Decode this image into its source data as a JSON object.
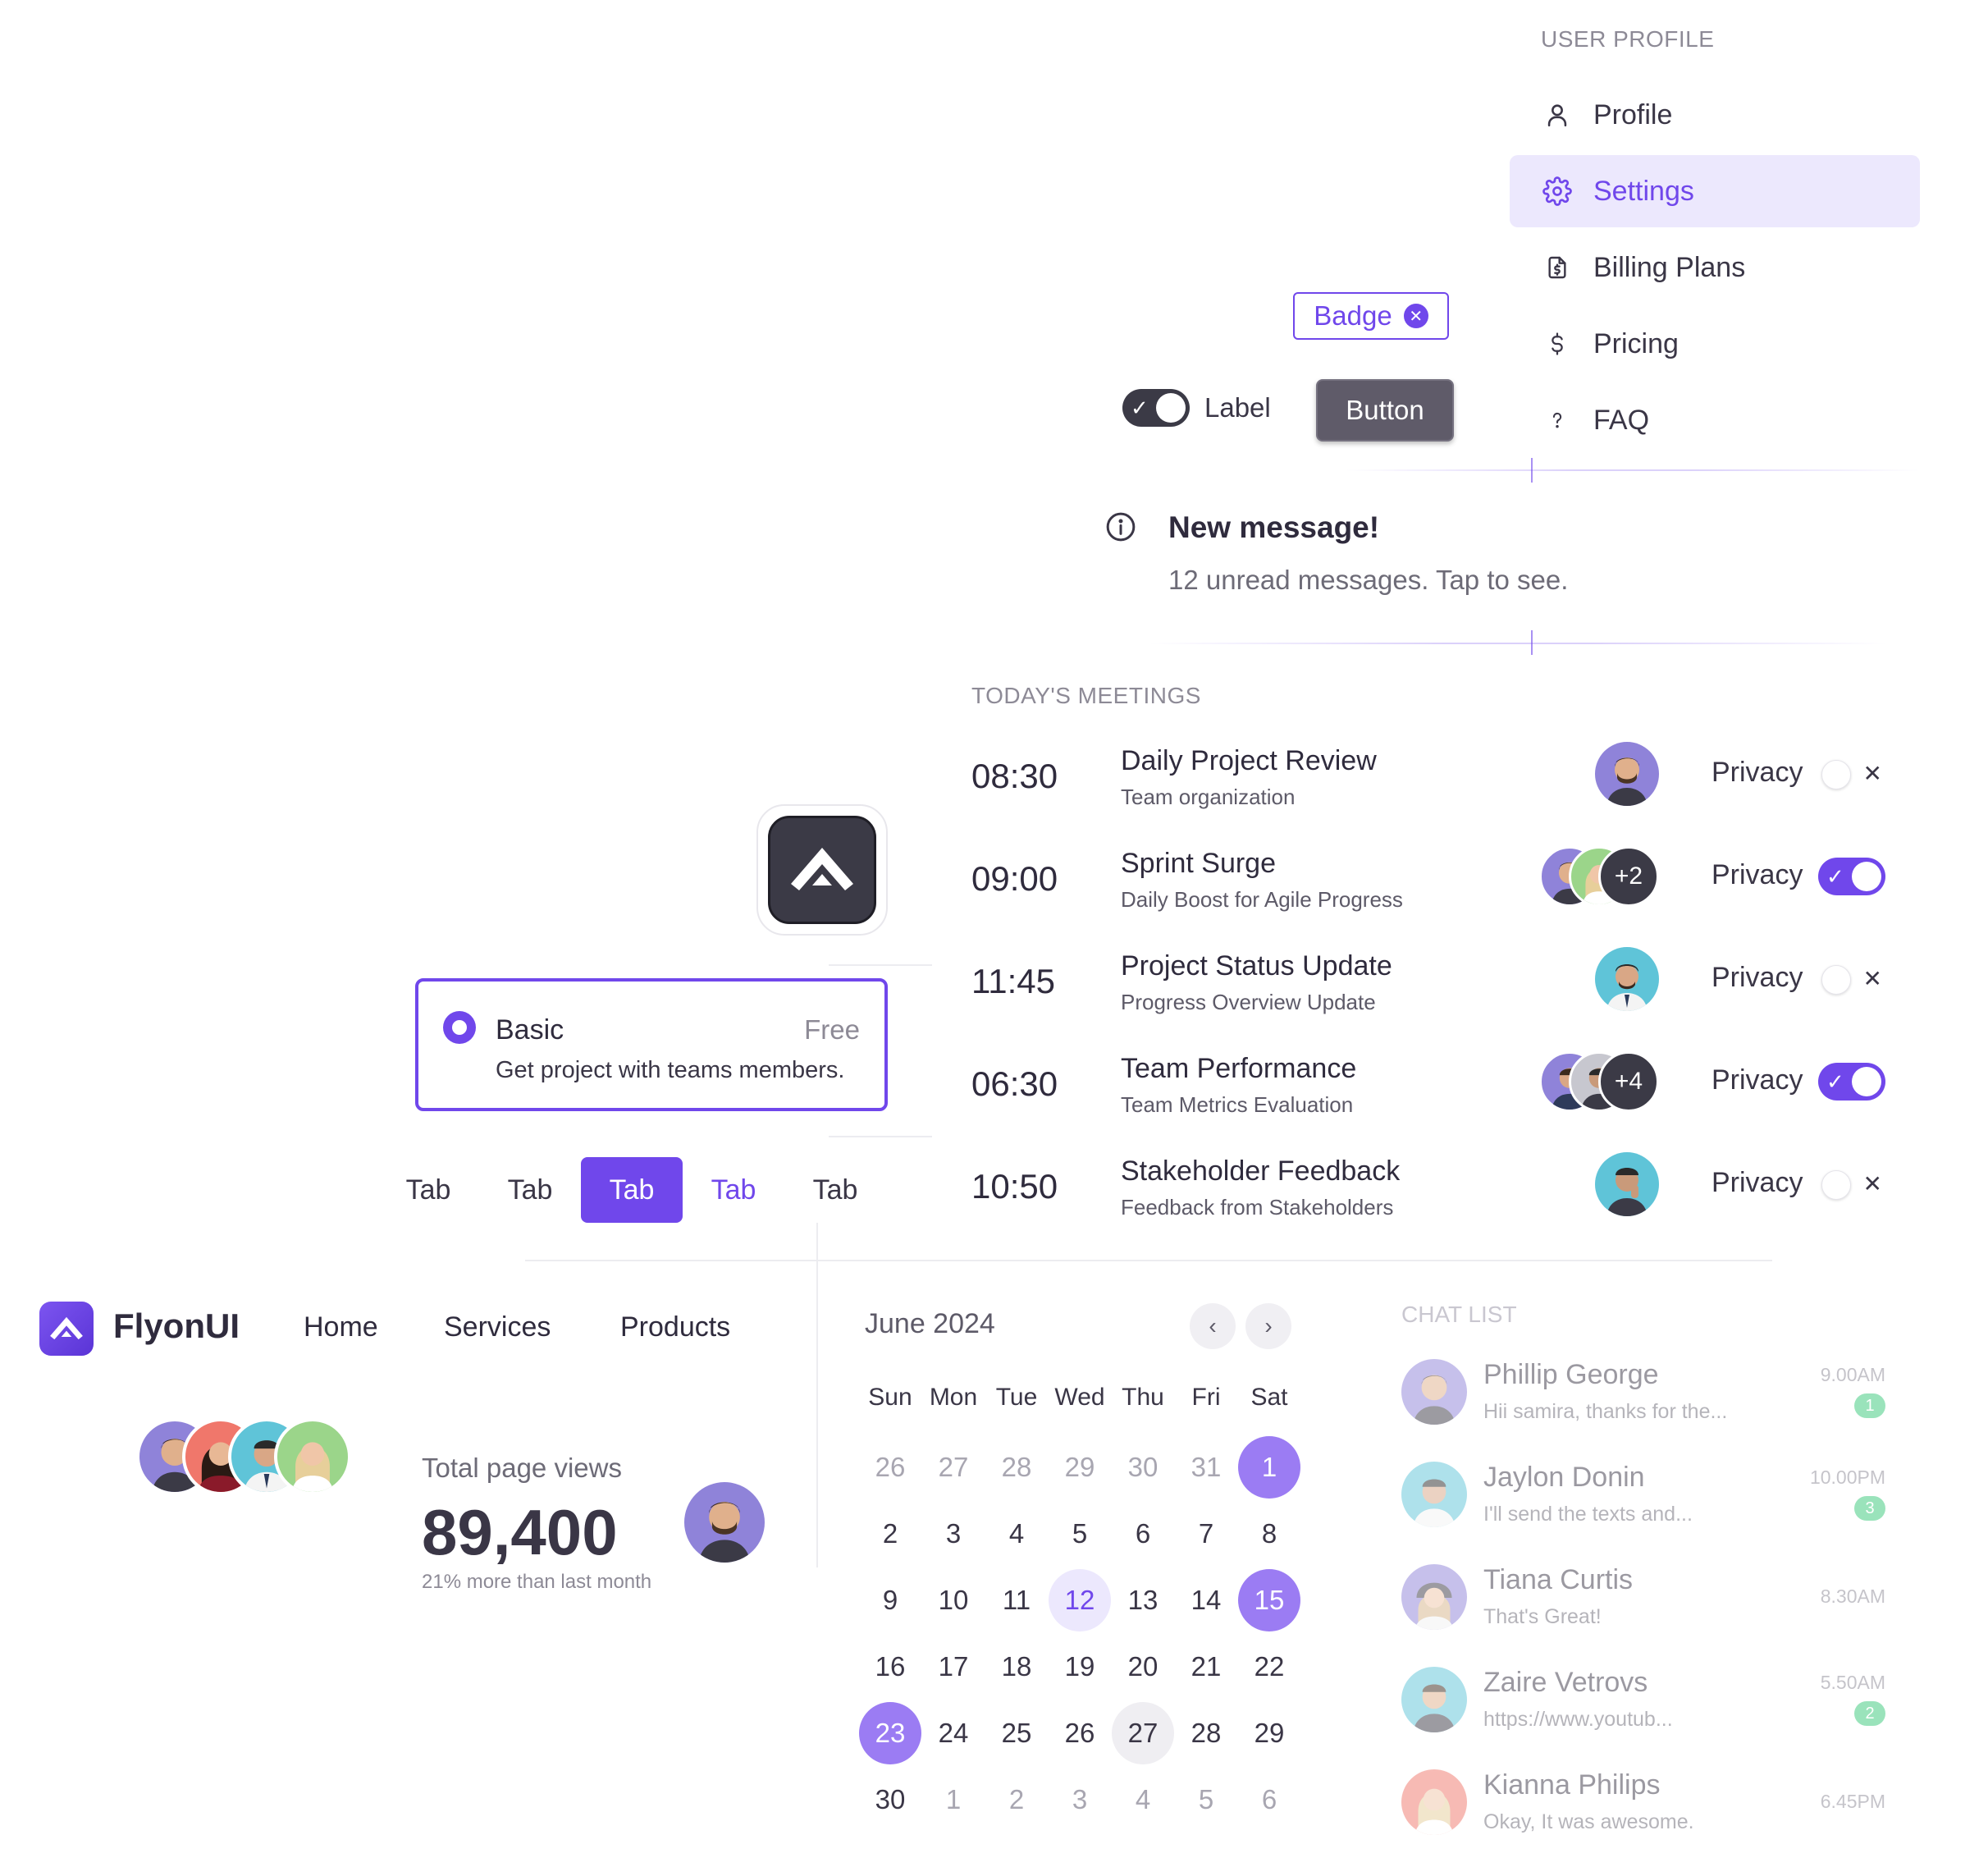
{
  "profile_menu": {
    "heading": "USER PROFILE",
    "items": [
      {
        "label": "Profile",
        "icon": "user-icon"
      },
      {
        "label": "Settings",
        "icon": "gear-icon",
        "active": true
      },
      {
        "label": "Billing Plans",
        "icon": "invoice-dollar-icon"
      },
      {
        "label": "Pricing",
        "icon": "dollar-icon"
      },
      {
        "label": "FAQ",
        "icon": "question-icon"
      }
    ]
  },
  "badge": {
    "label": "Badge",
    "icon": "close-circle-icon"
  },
  "toggle": {
    "label": "Label",
    "checked": true
  },
  "button": {
    "label": "Button"
  },
  "alert": {
    "title": "New message!",
    "text": "12 unread messages. Tap to see.",
    "icon": "info-circle-icon"
  },
  "meetings": {
    "heading": "TODAY'S MEETINGS",
    "privacy_label": "Privacy",
    "rows": [
      {
        "time": "08:30",
        "title": "Daily Project Review",
        "subtitle": "Team organization",
        "extra": "",
        "privacy": false
      },
      {
        "time": "09:00",
        "title": "Sprint Surge",
        "subtitle": "Daily Boost for Agile Progress",
        "extra": "+2",
        "privacy": true
      },
      {
        "time": "11:45",
        "title": "Project Status Update",
        "subtitle": "Progress Overview Update",
        "extra": "",
        "privacy": false
      },
      {
        "time": "06:30",
        "title": "Team Performance",
        "subtitle": "Team Metrics Evaluation",
        "extra": "+4",
        "privacy": true
      },
      {
        "time": "10:50",
        "title": "Stakeholder Feedback",
        "subtitle": "Feedback from Stakeholders",
        "extra": "",
        "privacy": false
      }
    ]
  },
  "plan": {
    "name": "Basic",
    "price": "Free",
    "description": "Get project with teams members.",
    "selected": true
  },
  "tabs": [
    {
      "label": "Tab",
      "state": "default"
    },
    {
      "label": "Tab",
      "state": "default"
    },
    {
      "label": "Tab",
      "state": "active"
    },
    {
      "label": "Tab",
      "state": "hover"
    },
    {
      "label": "Tab",
      "state": "default"
    }
  ],
  "navbar": {
    "brand": "FlyonUI",
    "links": [
      "Home",
      "Services",
      "Products"
    ]
  },
  "stats": {
    "label": "Total page views",
    "value": "89,400",
    "subtext": "21% more than last month"
  },
  "calendar": {
    "title": "June 2024",
    "weekdays": [
      "Sun",
      "Mon",
      "Tue",
      "Wed",
      "Thu",
      "Fri",
      "Sat"
    ],
    "weeks": [
      [
        "26",
        "27",
        "28",
        "29",
        "30",
        "31",
        "1"
      ],
      [
        "2",
        "3",
        "4",
        "5",
        "6",
        "7",
        "8"
      ],
      [
        "9",
        "10",
        "11",
        "12",
        "13",
        "14",
        "15"
      ],
      [
        "16",
        "17",
        "18",
        "19",
        "20",
        "21",
        "22"
      ],
      [
        "23",
        "24",
        "25",
        "26",
        "27",
        "28",
        "29"
      ],
      [
        "30",
        "1",
        "2",
        "3",
        "4",
        "5",
        "6"
      ]
    ],
    "selected": [
      "1",
      "15",
      "23"
    ],
    "highlighted": "12",
    "today": "27"
  },
  "chat": {
    "heading": "CHAT LIST",
    "items": [
      {
        "name": "Phillip George",
        "message": "Hii samira, thanks for the...",
        "time": "9.00AM",
        "count": "1"
      },
      {
        "name": "Jaylon Donin",
        "message": "I'll send the texts and...",
        "time": "10.00PM",
        "count": "3"
      },
      {
        "name": "Tiana Curtis",
        "message": "That's Great!",
        "time": "8.30AM",
        "count": ""
      },
      {
        "name": "Zaire Vetrovs",
        "message": "https://www.youtub...",
        "time": "5.50AM",
        "count": "2"
      },
      {
        "name": "Kianna Philips",
        "message": "Okay, It was awesome.",
        "time": "6.45PM",
        "count": ""
      }
    ]
  },
  "colors": {
    "primary": "#7047eb",
    "dark": "#3b3a46",
    "success": "#38c97a"
  }
}
